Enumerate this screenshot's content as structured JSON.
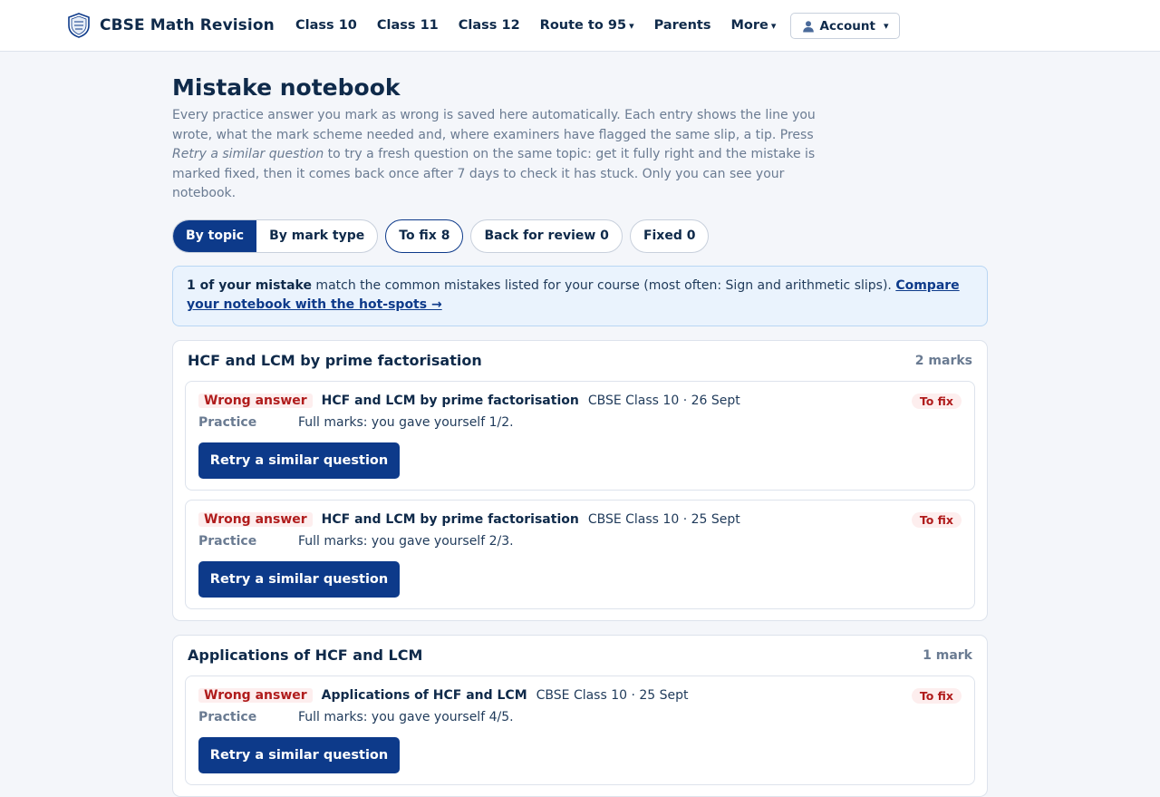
{
  "brand": {
    "name": "CBSE Math Revision"
  },
  "nav": {
    "items": [
      {
        "label": "Class 10",
        "dropdown": false
      },
      {
        "label": "Class 11",
        "dropdown": false
      },
      {
        "label": "Class 12",
        "dropdown": false
      },
      {
        "label": "Route to 95",
        "dropdown": true
      },
      {
        "label": "Parents",
        "dropdown": false
      },
      {
        "label": "More",
        "dropdown": true
      }
    ],
    "account_label": "Account"
  },
  "page": {
    "title": "Mistake notebook",
    "intro_part1": "Every practice answer you mark as wrong is saved here automatically. Each entry shows the line you wrote, what the mark scheme needed and, where examiners have flagged the same slip, a tip. Press ",
    "intro_emph": "Retry a similar question",
    "intro_part2": " to try a fresh question on the same topic: get it fully right and the mistake is marked fixed, then it comes back once after 7 days to check it has stuck. Only you can see your notebook."
  },
  "filters": {
    "view": [
      {
        "label": "By topic",
        "active": true
      },
      {
        "label": "By mark type",
        "active": false
      }
    ],
    "status": [
      {
        "label": "To fix 8",
        "selected": true
      },
      {
        "label": "Back for review 0",
        "selected": false
      },
      {
        "label": "Fixed 0",
        "selected": false
      }
    ]
  },
  "banner": {
    "bold": "1 of your mistake",
    "text": " match the common mistakes listed for your course (most often: Sign and arithmetic slips). ",
    "link": "Compare your notebook with the hot-spots →"
  },
  "groups": [
    {
      "title": "HCF and LCM by prime factorisation",
      "marks": "2 marks",
      "entries": [
        {
          "tag": "Wrong answer",
          "topic": "HCF and LCM by prime factorisation",
          "meta": "CBSE Class 10 · 26 Sept",
          "status": "To fix",
          "source": "Practice",
          "note": "Full marks: you gave yourself 1/2.",
          "button": "Retry a similar question"
        },
        {
          "tag": "Wrong answer",
          "topic": "HCF and LCM by prime factorisation",
          "meta": "CBSE Class 10 · 25 Sept",
          "status": "To fix",
          "source": "Practice",
          "note": "Full marks: you gave yourself 2/3.",
          "button": "Retry a similar question"
        }
      ]
    },
    {
      "title": "Applications of HCF and LCM",
      "marks": "1 mark",
      "entries": [
        {
          "tag": "Wrong answer",
          "topic": "Applications of HCF and LCM",
          "meta": "CBSE Class 10 · 25 Sept",
          "status": "To fix",
          "source": "Practice",
          "note": "Full marks: you gave yourself 4/5.",
          "button": "Retry a similar question"
        }
      ]
    }
  ],
  "colors": {
    "brand_navy": "#0d3a8a",
    "text_dark": "#0f2a4a",
    "muted": "#6a7b92",
    "error_red": "#b01c1c",
    "error_bg": "#fdeeee",
    "info_bg": "#eaf3fd"
  },
  "icons": {
    "logo": "shield-crest-icon",
    "account": "person-icon",
    "dropdown": "caret-down-icon"
  }
}
